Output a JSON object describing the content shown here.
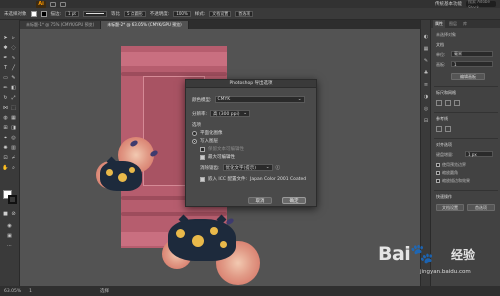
{
  "app": {
    "logo": "Ai",
    "workspace_label": "传统基本功能",
    "search_placeholder": "搜索 Adobe Stock"
  },
  "controlbar": {
    "selection_label": "未选择对象",
    "stroke_label": "描边:",
    "stroke_weight": "1 pt",
    "stroke_style": "等比",
    "brush_label": "5 点圆形",
    "opacity_label": "不透明度:",
    "opacity_value": "100%",
    "style_label": "样式:",
    "doc_setup_label": "文档设置",
    "prefs_label": "首选项"
  },
  "tabs": [
    {
      "label": "未标题-1* @ 75% (CMYK/GPU 预览)",
      "active": false
    },
    {
      "label": "未标题-2* @ 63.05% (CMYK/GPU 预览)",
      "active": true
    }
  ],
  "dialog": {
    "title": "Photoshop 导出选项",
    "color_model_label": "颜色模型:",
    "color_model_value": "CMYK",
    "resolution_label": "分辨率:",
    "resolution_value": "高 (300 ppi)",
    "options_label": "选项",
    "flat_image_label": "平面化图像",
    "write_layers_label": "写入图层",
    "preserve_text_label": "保留文本可编辑性",
    "max_editability_label": "最大可编辑性",
    "antialias_label": "消除锯齿:",
    "antialias_value": "优化文字(提示)",
    "embed_icc_label": "嵌入 ICC 配置文件:",
    "icc_profile": "Japan Color 2001 Coated",
    "cancel_label": "取消",
    "ok_label": "确定"
  },
  "panel": {
    "tabs": [
      "属性",
      "图层",
      "库"
    ],
    "no_selection": "未选择对象",
    "doc_section": "文档",
    "unit_label": "单位:",
    "unit_value": "毫米",
    "artboard_label": "画板:",
    "artboard_value": "1",
    "edit_artboard_button": "编辑画板",
    "rulers_section": "标尺和网格",
    "guides_section": "参考线",
    "snap_section": "对齐选项",
    "keyboard_increment_label": "键盘增量:",
    "keyboard_increment_value": "1 px",
    "snap_bounds_label": "使用预览边界",
    "snap_round_label": "缩放圆角",
    "snap_stroke_label": "缩放描边和效果",
    "quick_actions": "快速操作",
    "doc_settings_button": "文档设置",
    "preferences_button": "首选项"
  },
  "statusbar": {
    "zoom": "63.05%",
    "page": "1",
    "tool_name": "选择"
  },
  "watermark": {
    "brand": "Bai🐾",
    "brand_sub": "经验",
    "url": "jingyan.baidu.com"
  },
  "colors": {
    "artboard_pink": "#b65d6e",
    "pig_navy": "#1d2a3c",
    "gold": "#e9b94a",
    "ui_dark": "#535353"
  }
}
